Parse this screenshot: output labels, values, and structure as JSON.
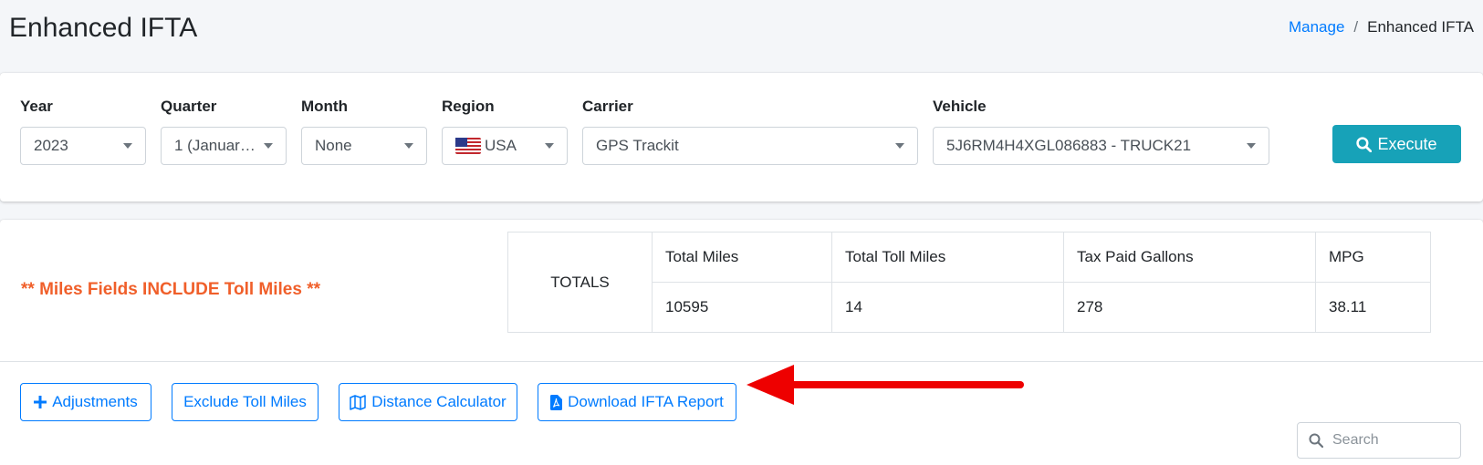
{
  "header": {
    "title": "Enhanced IFTA",
    "breadcrumb": {
      "link": "Manage",
      "separator": "/",
      "current": "Enhanced IFTA"
    }
  },
  "filters": {
    "year": {
      "label": "Year",
      "value": "2023"
    },
    "quarter": {
      "label": "Quarter",
      "value": "1 (Januar…"
    },
    "month": {
      "label": "Month",
      "value": "None"
    },
    "region": {
      "label": "Region",
      "value": "USA",
      "flag_icon": "us-flag-icon"
    },
    "carrier": {
      "label": "Carrier",
      "value": "GPS Trackit"
    },
    "vehicle": {
      "label": "Vehicle",
      "value": "5J6RM4H4XGL086883 - TRUCK21"
    },
    "execute_label": "Execute"
  },
  "summary": {
    "notice": "** Miles Fields INCLUDE Toll Miles **",
    "totals_label": "TOTALS",
    "columns": [
      "Total Miles",
      "Total Toll Miles",
      "Tax Paid Gallons",
      "MPG"
    ],
    "values": [
      "10595",
      "14",
      "278",
      "38.11"
    ]
  },
  "actions": {
    "adjustments": "Adjustments",
    "exclude_toll": "Exclude Toll Miles",
    "distance_calc": "Distance Calculator",
    "download_report": "Download IFTA Report"
  },
  "search": {
    "placeholder": "Search"
  },
  "colors": {
    "primary": "#007bff",
    "execute": "#17a2b8",
    "notice": "#f05f2a",
    "annotation_arrow": "#ee0000"
  }
}
